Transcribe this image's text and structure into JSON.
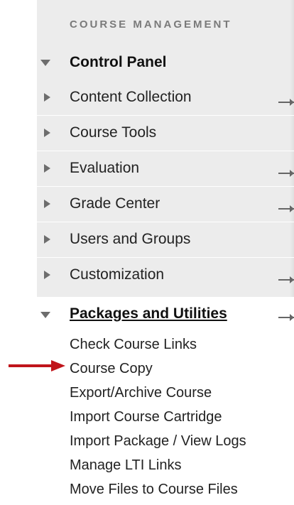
{
  "section_header": "COURSE MANAGEMENT",
  "control_panel": {
    "label": "Control Panel",
    "items": [
      {
        "label": "Content Collection",
        "has_arrow": true
      },
      {
        "label": "Course Tools",
        "has_arrow": false
      },
      {
        "label": "Evaluation",
        "has_arrow": true
      },
      {
        "label": "Grade Center",
        "has_arrow": true
      },
      {
        "label": "Users and Groups",
        "has_arrow": false
      },
      {
        "label": "Customization",
        "has_arrow": true
      }
    ]
  },
  "packages": {
    "label": "Packages and Utilities",
    "items": [
      {
        "label": "Check Course Links"
      },
      {
        "label": "Course Copy"
      },
      {
        "label": "Export/Archive Course"
      },
      {
        "label": "Import Course Cartridge"
      },
      {
        "label": "Import Package / View Logs"
      },
      {
        "label": "Manage LTI Links"
      },
      {
        "label": "Move Files to Course Files"
      }
    ]
  },
  "colors": {
    "panel_background": "#ececec",
    "text": "#222222",
    "annotation_arrow": "#c0151b"
  }
}
